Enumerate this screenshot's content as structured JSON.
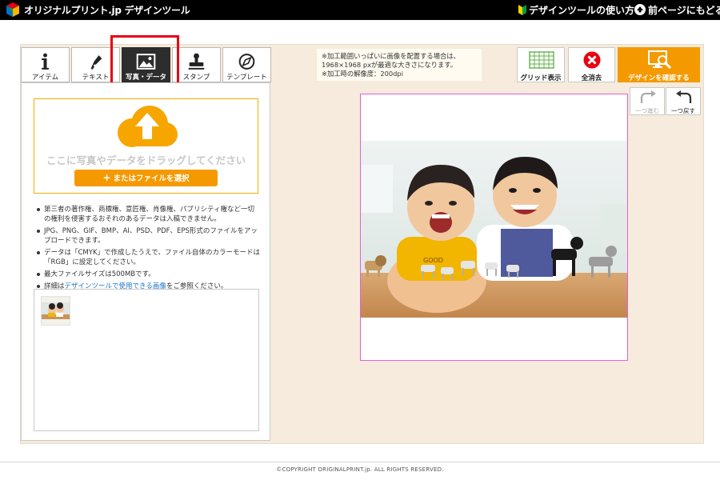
{
  "header": {
    "brand": "オリジナルプリント.jp デザインツール",
    "help_link": "デザインツールの使い方",
    "back_link": "前ページにもどる"
  },
  "tabs": [
    {
      "label": "アイテム",
      "icon": "info-icon",
      "active": false
    },
    {
      "label": "テキスト",
      "icon": "pen-icon",
      "active": false
    },
    {
      "label": "写真・データ",
      "icon": "image-icon",
      "active": true
    },
    {
      "label": "スタンプ",
      "icon": "stamp-icon",
      "active": false
    },
    {
      "label": "テンプレート",
      "icon": "compass-icon",
      "active": false
    }
  ],
  "upload": {
    "drop_text": "ここに写真やデータをドラッグしてください",
    "select_button": "またはファイルを選択",
    "icon": "cloud-upload-icon"
  },
  "notes": [
    "第三者の著作権、商標権、意匠権、肖像権、パブリシティ権など一切の権利を侵害するおそれのあるデータは入稿できません。",
    "JPG、PNG、GIF、BMP、AI、PSD、PDF、EPS形式のファイルをアップロードできます。",
    "データは「CMYK」で作成したうえで、ファイル自体のカラーモードは「RGB」に設定してください。",
    "最大ファイルサイズは500MBです。"
  ],
  "note_link": {
    "prefix": "詳細は",
    "link": "デザインツールで使用できる画像",
    "suffix": "をご参照ください。"
  },
  "notice": {
    "line1": "※加工範囲いっぱいに画像を配置する場合は、",
    "line2": "1968×1968 pxが最適な大きさになります。",
    "line3": "※加工時の解像度：200dpi"
  },
  "toolbar": {
    "grid_label": "グリッド表示",
    "clear_label": "全消去",
    "confirm_label": "デザインを確認する",
    "redo_label": "一つ進む",
    "undo_label": "一つ戻す"
  },
  "footer": {
    "copyright": "©COPYRIGHT ORIGINALPRINT.jp. ALL RIGHTS RESERVED."
  },
  "colors": {
    "accent": "#f49a00",
    "highlight": "#e60012",
    "canvas_border": "#e15fe0",
    "workspace_bg": "#f6ebdc"
  }
}
